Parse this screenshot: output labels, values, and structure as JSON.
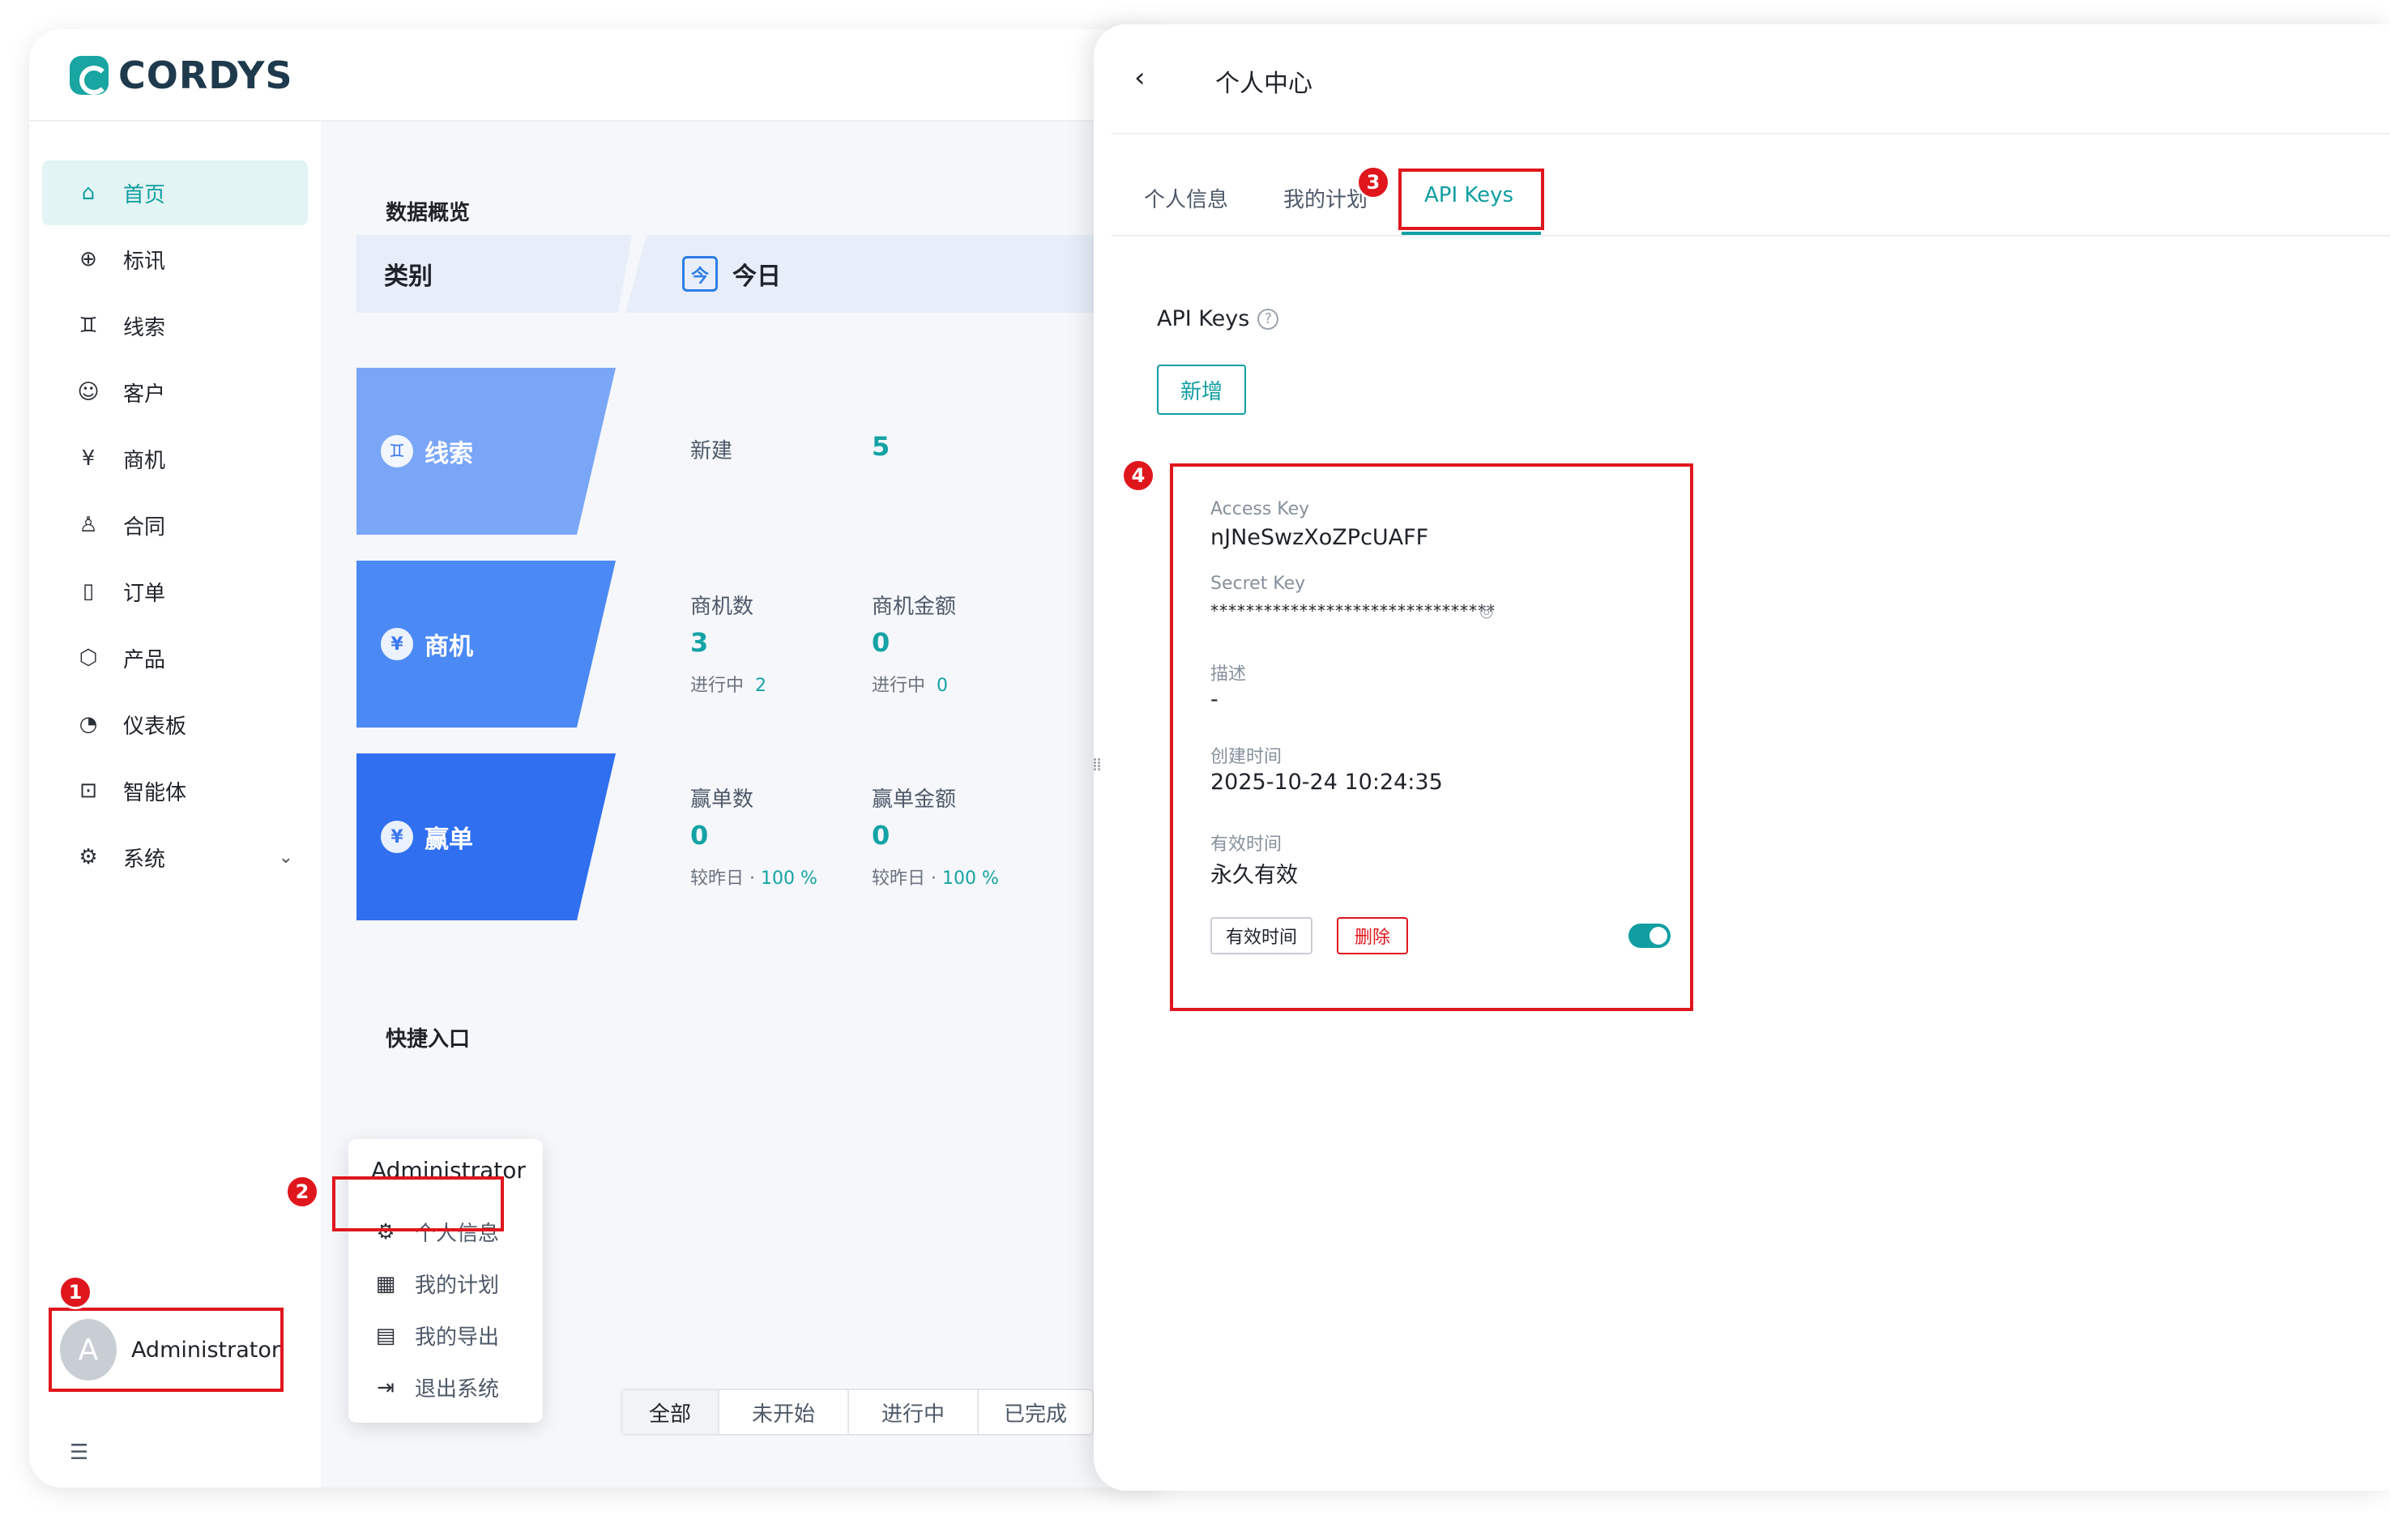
{
  "brand": {
    "name": "CORDYS"
  },
  "sidebar": {
    "items": [
      {
        "label": "首页",
        "icon": "home-icon"
      },
      {
        "label": "标讯",
        "icon": "crosshair-icon"
      },
      {
        "label": "线索",
        "icon": "lead-icon"
      },
      {
        "label": "客户",
        "icon": "customer-icon"
      },
      {
        "label": "商机",
        "icon": "yen-icon"
      },
      {
        "label": "合同",
        "icon": "stamp-icon"
      },
      {
        "label": "订单",
        "icon": "order-icon"
      },
      {
        "label": "产品",
        "icon": "box-icon"
      },
      {
        "label": "仪表板",
        "icon": "gauge-icon"
      },
      {
        "label": "智能体",
        "icon": "robot-icon"
      },
      {
        "label": "系统",
        "icon": "gear-icon"
      }
    ],
    "user": {
      "avatar_letter": "A",
      "name": "Administrator"
    }
  },
  "main": {
    "overview_title": "数据概览",
    "table_head": {
      "category": "类别",
      "period_icon": "今",
      "period": "今日"
    },
    "cards": {
      "leads": {
        "label": "线索",
        "icon": "♊",
        "new_label": "新建",
        "new_value": "5"
      },
      "opportunities": {
        "label": "商机",
        "icon": "¥",
        "count_label": "商机数",
        "count_value": "3",
        "count_sub_label": "进行中",
        "count_sub_value": "2",
        "amount_label": "商机金额",
        "amount_value": "0",
        "amount_sub_label": "进行中",
        "amount_sub_value": "0"
      },
      "wins": {
        "label": "赢单",
        "icon": "¥",
        "count_label": "赢单数",
        "count_value": "0",
        "count_sub_label": "较昨日",
        "count_sub_value": "100 %",
        "amount_label": "赢单金额",
        "amount_value": "0",
        "amount_sub_label": "较昨日",
        "amount_sub_value": "100 %"
      }
    },
    "shortcuts_title": "快捷入口",
    "filter_tabs": [
      "全部",
      "未开始",
      "进行中",
      "已完成"
    ]
  },
  "popup": {
    "title": "Administrator",
    "items": [
      {
        "label": "个人信息",
        "icon": "gear-icon"
      },
      {
        "label": "我的计划",
        "icon": "calendar-icon"
      },
      {
        "label": "我的导出",
        "icon": "export-icon"
      },
      {
        "label": "退出系统",
        "icon": "logout-icon"
      }
    ]
  },
  "drawer": {
    "title": "个人中心",
    "tabs": [
      "个人信息",
      "我的计划",
      "API Keys"
    ],
    "active_tab": "API Keys",
    "section_title": "API Keys",
    "new_button": "新增",
    "key": {
      "access_key_label": "Access Key",
      "access_key_value": "nJNeSwzXoZPcUAFF",
      "secret_key_label": "Secret Key",
      "secret_key_value": "********************************",
      "description_label": "描述",
      "description_value": "-",
      "created_label": "创建时间",
      "created_value": "2025-10-24 10:24:35",
      "expiry_label": "有效时间",
      "expiry_value": "永久有效",
      "expiry_button": "有效时间",
      "delete_button": "删除",
      "enabled": true
    }
  },
  "annotations": [
    "1",
    "2",
    "3",
    "4"
  ],
  "colors": {
    "accent": "#109ea1",
    "highlight": "#e0161d",
    "brand": "#19a5a1"
  }
}
